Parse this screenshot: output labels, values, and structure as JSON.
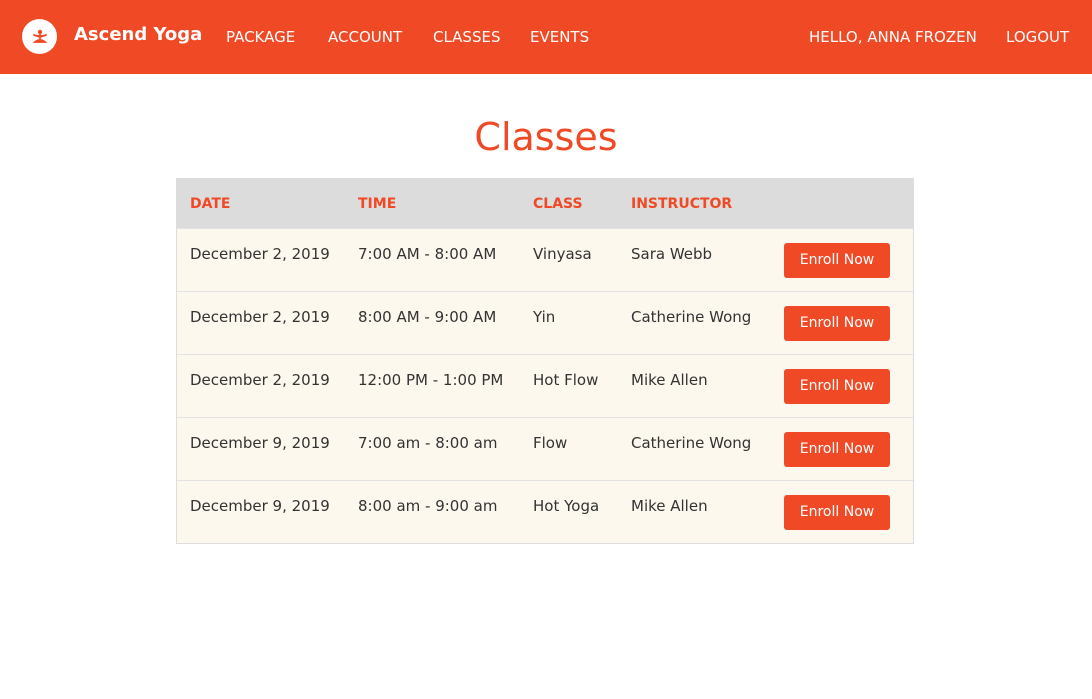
{
  "header": {
    "brand": "Ascend Yoga",
    "logo_icon": "yoga-pose-icon",
    "nav": [
      "PACKAGE",
      "ACCOUNT",
      "CLASSES",
      "EVENTS"
    ],
    "greeting": "HELLO, ANNA FROZEN",
    "logout": "LOGOUT"
  },
  "colors": {
    "accent": "#f04925",
    "row_bg": "#fdf8ee",
    "header_bg": "#dcdcdc"
  },
  "page": {
    "title": "Classes"
  },
  "table": {
    "columns": [
      "DATE",
      "TIME",
      "CLASS",
      "INSTRUCTOR"
    ],
    "rows": [
      {
        "date": "December 2, 2019",
        "time": "7:00 AM - 8:00 AM",
        "class": "Vinyasa",
        "instructor": "Sara Webb",
        "action": "Enroll Now"
      },
      {
        "date": "December 2, 2019",
        "time": "8:00 AM - 9:00 AM",
        "class": "Yin",
        "instructor": "Catherine Wong",
        "action": "Enroll Now"
      },
      {
        "date": "December 2, 2019",
        "time": "12:00 PM - 1:00 PM",
        "class": "Hot Flow",
        "instructor": "Mike Allen",
        "action": "Enroll Now"
      },
      {
        "date": "December 9, 2019",
        "time": "7:00 am - 8:00 am",
        "class": "Flow",
        "instructor": "Catherine Wong",
        "action": "Enroll Now"
      },
      {
        "date": "December 9, 2019",
        "time": "8:00 am - 9:00 am",
        "class": "Hot Yoga",
        "instructor": "Mike Allen",
        "action": "Enroll Now"
      }
    ]
  }
}
